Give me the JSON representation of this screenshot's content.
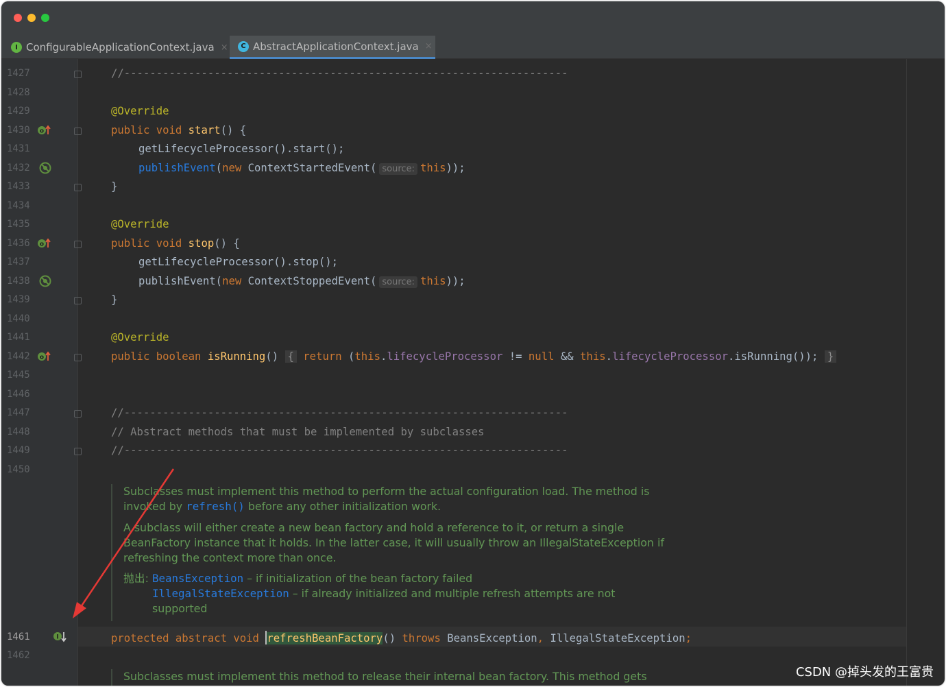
{
  "window": {
    "traffic_lights": {
      "close": "#ff5f57",
      "minimize": "#febc2e",
      "zoom": "#28c840"
    }
  },
  "tabs": [
    {
      "label": "ConfigurableApplicationContext.java",
      "icon": "interface-icon",
      "close": "×",
      "active": false
    },
    {
      "label": "AbstractApplicationContext.java",
      "icon": "class-icon",
      "close": "×",
      "active": true
    }
  ],
  "gutter": {
    "lines": [
      "1427",
      "1428",
      "1429",
      "1430",
      "1431",
      "1432",
      "1433",
      "1434",
      "1435",
      "1436",
      "1437",
      "1438",
      "1439",
      "1440",
      "1441",
      "1442",
      "1445",
      "1446",
      "1447",
      "1448",
      "1449",
      "1450",
      "1461",
      "1462"
    ]
  },
  "code": {
    "l1427": "//---------------------------------------------------------------------",
    "l1429": "@Override",
    "l1430_kw": "public void",
    "l1430_fn": "start",
    "l1430_rest": "() {",
    "l1431": "getLifecycleProcessor().start();",
    "l1432_call": "publishEvent",
    "l1432_new": "new",
    "l1432_cls": "ContextStartedEvent(",
    "l1432_hint": "source:",
    "l1432_this": "this",
    "l1432_end": "));",
    "l1433": "}",
    "l1435": "@Override",
    "l1436_kw": "public void",
    "l1436_fn": "stop",
    "l1436_rest": "() {",
    "l1437": "getLifecycleProcessor().stop();",
    "l1438_call": "publishEvent(",
    "l1438_new": "new",
    "l1438_cls": "ContextStoppedEvent(",
    "l1438_hint": "source:",
    "l1438_this": "this",
    "l1438_end": "));",
    "l1439": "}",
    "l1441": "@Override",
    "l1442_kw": "public boolean",
    "l1442_fn": "isRunning",
    "l1442_paren": "()",
    "l1442_open": "{",
    "l1442_return": "return",
    "l1442_p1": "(",
    "l1442_this1": "this",
    "l1442_field1": "lifecycleProcessor",
    "l1442_ne": " != ",
    "l1442_null": "null",
    "l1442_and": " && ",
    "l1442_this2": "this",
    "l1442_field2": "lifecycleProcessor",
    "l1442_call": ".isRunning());",
    "l1442_close": "}",
    "l1447": "//---------------------------------------------------------------------",
    "l1448": "// Abstract methods that must be implemented by subclasses",
    "l1449": "//---------------------------------------------------------------------",
    "l1461_kw": "protected abstract void",
    "l1461_fn": "refreshBeanFactory",
    "l1461_paren": "()",
    "l1461_throws": "throws",
    "l1461_ex1": "BeansException",
    "l1461_comma": ",",
    "l1461_ex2": "IllegalStateException",
    "l1461_semi": ";"
  },
  "doc1": {
    "p1_a": "Subclasses must implement this method to perform the actual configuration load. The method is",
    "p1_b1": "invoked by",
    "p1_code": "refresh()",
    "p1_b2": "before any other initialization work.",
    "p2_a": "A subclass will either create a new bean factory and hold a reference to it, or return a single",
    "p2_b": "BeanFactory instance that it holds. In the latter case, it will usually throw an IllegalStateException if",
    "p2_c": "refreshing the context more than once.",
    "throws_label": "抛出:",
    "t1_code": "BeansException",
    "t1_text": "– if initialization of the bean factory failed",
    "t2_code": "IllegalStateException",
    "t2_text": "– if already initialized and multiple refresh attempts are not",
    "t2_cont": "supported"
  },
  "doc2": {
    "p1": "Subclasses must implement this method to release their internal bean factory. This method gets"
  },
  "watermark": "CSDN @掉头发的王富贵",
  "colors": {
    "annotation_arrow": "#e53935"
  }
}
